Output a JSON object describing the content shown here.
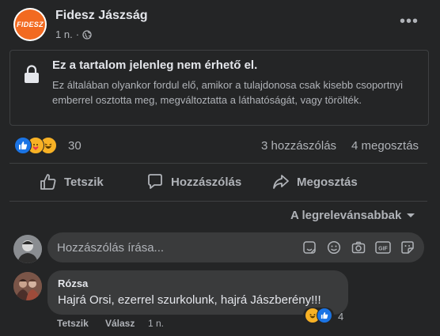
{
  "post": {
    "page_name": "Fidesz Jászság",
    "logo_text": "FIDESZ",
    "time": "1 n.",
    "unavailable_title": "Ez a tartalom jelenleg nem érhető el.",
    "unavailable_text": "Ez általában olyankor fordul elő, amikor a tulajdonosa csak kisebb csoportnyi emberrel osztotta meg, megváltoztatta a láthatóságát, vagy törölték.",
    "more_label": "•••"
  },
  "stats": {
    "reactions": "30",
    "comments": "3 hozzászólás",
    "shares": "4 megosztás"
  },
  "actions": {
    "like": "Tetszik",
    "comment": "Hozzászólás",
    "share": "Megosztás"
  },
  "sort": {
    "label": "A legrelevánsabbak"
  },
  "composer": {
    "placeholder": "Hozzászólás írása..."
  },
  "comment": {
    "author": "Rózsa",
    "text": "Hajrá Orsi, ezerrel szurkolunk, hajrá Jászberény!!!",
    "reaction_count": "4",
    "like_label": "Tetszik",
    "reply_label": "Válasz",
    "time": "1 n."
  },
  "colors": {
    "background": "#242526",
    "surface": "#3a3b3c",
    "text_primary": "#e4e6eb",
    "text_secondary": "#b0b3b8",
    "fidesz_orange": "#f26a21",
    "like_blue": "#1b74e4"
  },
  "icons": [
    "globe-icon",
    "lock-icon",
    "like-reaction-icon",
    "care-reaction-icon",
    "haha-reaction-icon",
    "thumbs-up-icon",
    "comment-icon",
    "share-icon",
    "chevron-down-icon",
    "sticker-icon",
    "emoji-icon",
    "camera-icon",
    "gif-icon",
    "sticker-smile-icon"
  ]
}
